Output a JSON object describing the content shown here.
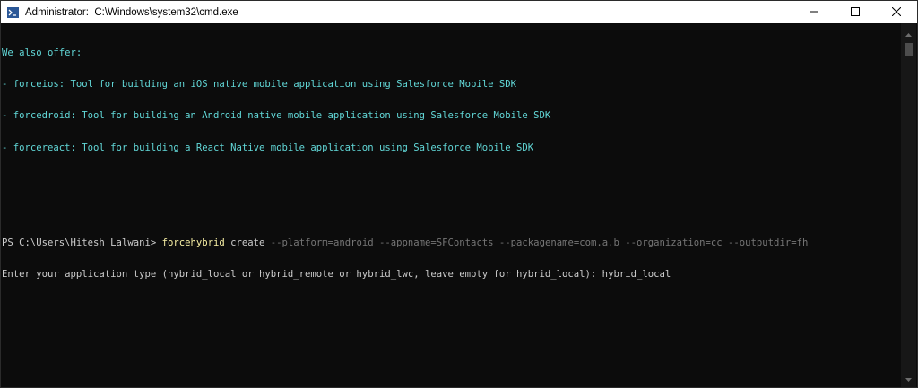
{
  "window": {
    "title_user": "Administrator:",
    "title_path": "C:\\Windows\\system32\\cmd.exe",
    "app_icon": "powershell-icon",
    "caption": {
      "minimize_icon": "minimize-icon",
      "maximize_icon": "maximize-icon",
      "close_icon": "close-icon"
    }
  },
  "colors": {
    "background": "#0c0c0c",
    "text": "#cccccc",
    "cyan": "#61d6d6",
    "command": "#f9f1a5",
    "params": "#767676"
  },
  "console": {
    "offer_header": "We also offer:",
    "offer_lines": [
      "- forceios: Tool for building an iOS native mobile application using Salesforce Mobile SDK",
      "- forcedroid: Tool for building an Android native mobile application using Salesforce Mobile SDK",
      "- forcereact: Tool for building a React Native mobile application using Salesforce Mobile SDK"
    ],
    "prompt": "PS C:\\Users\\Hitesh Lalwani> ",
    "command": "forcehybrid",
    "subcommand": " create",
    "params": " --platform=android --appname=SFContacts --packagename=com.a.b --organization=cc --outputdir=fh",
    "question": "Enter your application type (hybrid_local or hybrid_remote or hybrid_lwc, leave empty for hybrid_local): hybrid_local"
  }
}
